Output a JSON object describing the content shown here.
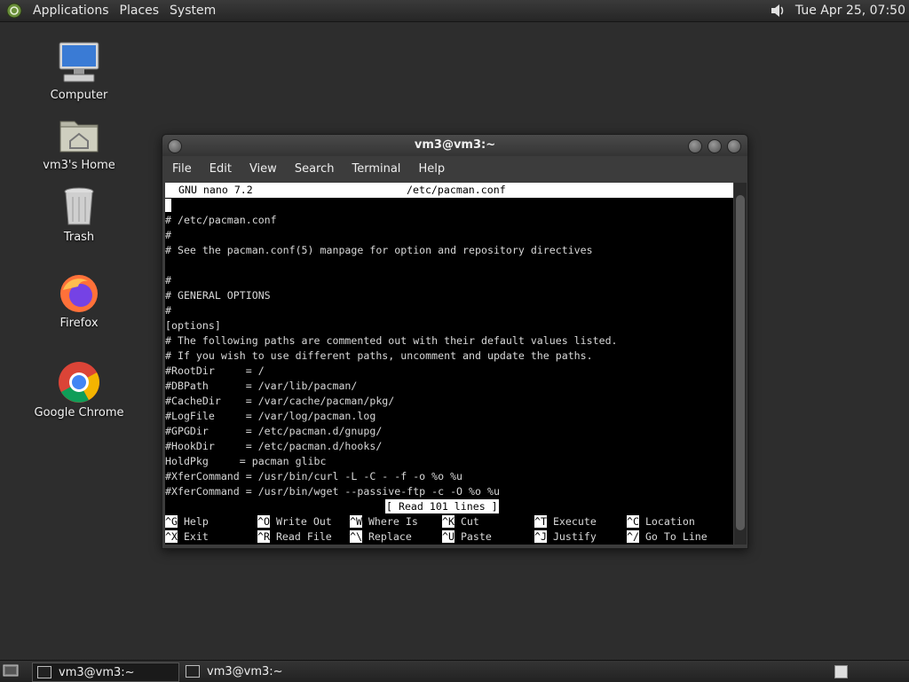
{
  "top_panel": {
    "menus": [
      "Applications",
      "Places",
      "System"
    ],
    "clock": "Tue Apr 25, 07:50"
  },
  "desktop_icons": [
    "Computer",
    "vm3's Home",
    "Trash",
    "Firefox",
    "Google Chrome"
  ],
  "window": {
    "title": "vm3@vm3:~",
    "menus": [
      "File",
      "Edit",
      "View",
      "Search",
      "Terminal",
      "Help"
    ]
  },
  "nano": {
    "version": "GNU nano 7.2",
    "filename": "/etc/pacman.conf",
    "lines": [
      "#",
      "# /etc/pacman.conf",
      "#",
      "# See the pacman.conf(5) manpage for option and repository directives",
      "",
      "#",
      "# GENERAL OPTIONS",
      "#",
      "[options]",
      "# The following paths are commented out with their default values listed.",
      "# If you wish to use different paths, uncomment and update the paths.",
      "#RootDir     = /",
      "#DBPath      = /var/lib/pacman/",
      "#CacheDir    = /var/cache/pacman/pkg/",
      "#LogFile     = /var/log/pacman.log",
      "#GPGDir      = /etc/pacman.d/gnupg/",
      "#HookDir     = /etc/pacman.d/hooks/",
      "HoldPkg     = pacman glibc",
      "#XferCommand = /usr/bin/curl -L -C - -f -o %o %u",
      "#XferCommand = /usr/bin/wget --passive-ftp -c -O %o %u"
    ],
    "status": "[ Read 101 lines ]",
    "shortcuts_row1": [
      {
        "key": "^G",
        "label": "Help"
      },
      {
        "key": "^O",
        "label": "Write Out"
      },
      {
        "key": "^W",
        "label": "Where Is"
      },
      {
        "key": "^K",
        "label": "Cut"
      },
      {
        "key": "^T",
        "label": "Execute"
      },
      {
        "key": "^C",
        "label": "Location"
      }
    ],
    "shortcuts_row2": [
      {
        "key": "^X",
        "label": "Exit"
      },
      {
        "key": "^R",
        "label": "Read File"
      },
      {
        "key": "^\\",
        "label": "Replace"
      },
      {
        "key": "^U",
        "label": "Paste"
      },
      {
        "key": "^J",
        "label": "Justify"
      },
      {
        "key": "^/",
        "label": "Go To Line"
      }
    ]
  },
  "taskbar": {
    "tasks": [
      "vm3@vm3:~",
      "vm3@vm3:~"
    ]
  }
}
